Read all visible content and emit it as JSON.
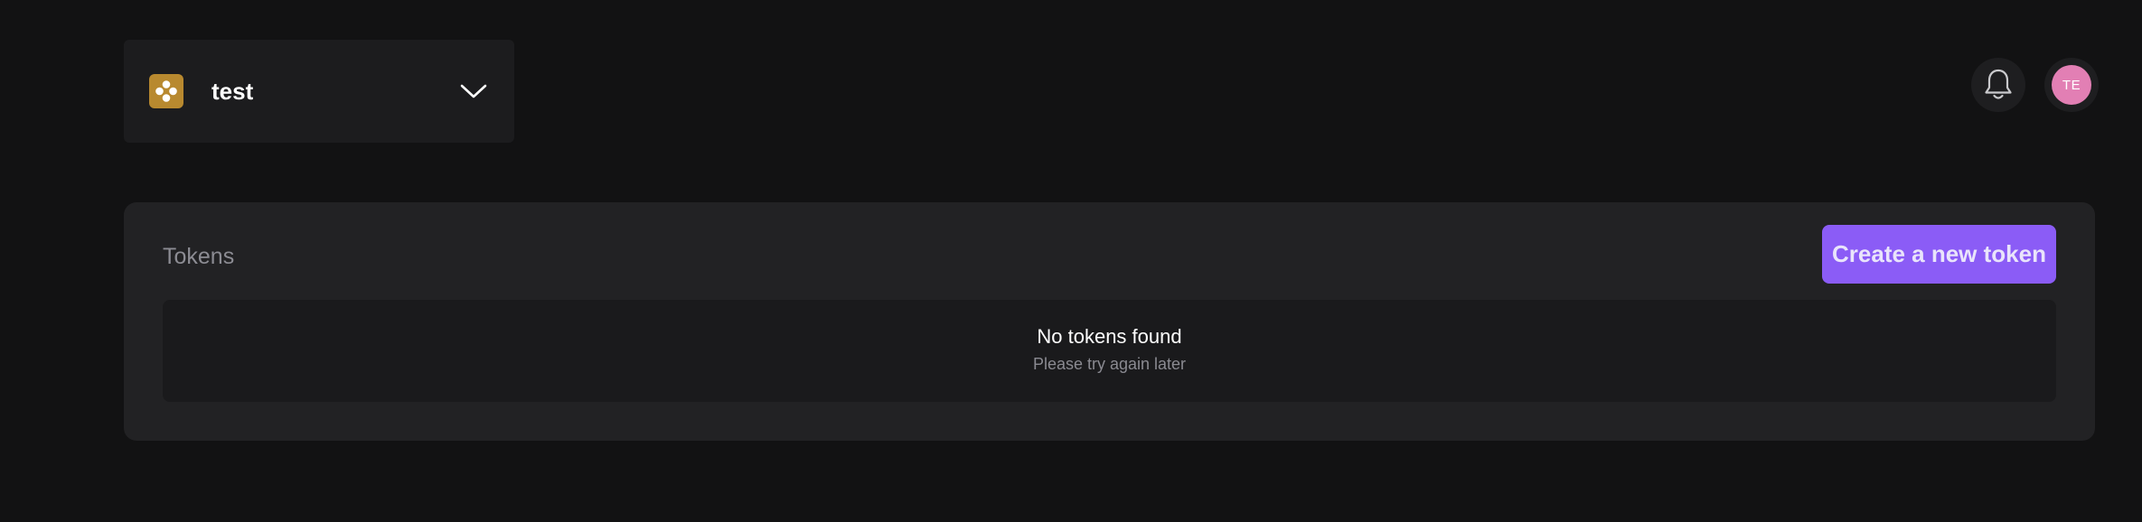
{
  "workspace": {
    "name": "test",
    "logo_color": "#b8892f"
  },
  "header": {
    "notifications_icon": "bell-icon",
    "avatar_initials": "TE",
    "avatar_color": "#e27fb4"
  },
  "tokens_panel": {
    "title": "Tokens",
    "create_button_label": "Create a new token",
    "accent_color": "#8b5cf6",
    "empty_state": {
      "title": "No tokens found",
      "subtitle": "Please try again later"
    }
  }
}
